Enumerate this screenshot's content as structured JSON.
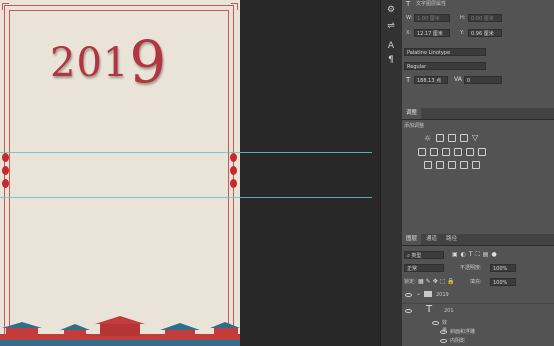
{
  "document": {
    "year_left": "201",
    "year_right": "9"
  },
  "properties_panel": {
    "title": "文字图层属性",
    "w_label": "W:",
    "w_value": "1.00 厘米",
    "h_label": "H:",
    "h_value": "0.00 厘米",
    "x_label": "X:",
    "x_value": "12.17 厘米",
    "y_label": "Y:",
    "y_value": "0.96 厘米",
    "font_family": "Palatino Linotype",
    "font_style": "Regular",
    "font_size": "188.13 点",
    "tracking": "0"
  },
  "adjustments_panel": {
    "tab": "调整",
    "add_label": "添加调整"
  },
  "layers_panel": {
    "tabs": [
      "图层",
      "通道",
      "路径"
    ],
    "filter_kind": "类型",
    "blend_mode": "正常",
    "opacity_label": "不透明度:",
    "opacity_value": "100%",
    "lock_label": "锁定:",
    "fill_label": "填充:",
    "fill_value": "100%",
    "layers": [
      {
        "name": "2019",
        "type": "group"
      },
      {
        "name": "201",
        "type": "text"
      }
    ],
    "effects_label": "效果",
    "effect_bevel": "斜面和浮雕",
    "effect_inner_shadow": "内阴影"
  },
  "colors": {
    "accent_red": "#b2353f",
    "guide_cyan": "#5ac8d4",
    "panel_bg": "#535353"
  }
}
